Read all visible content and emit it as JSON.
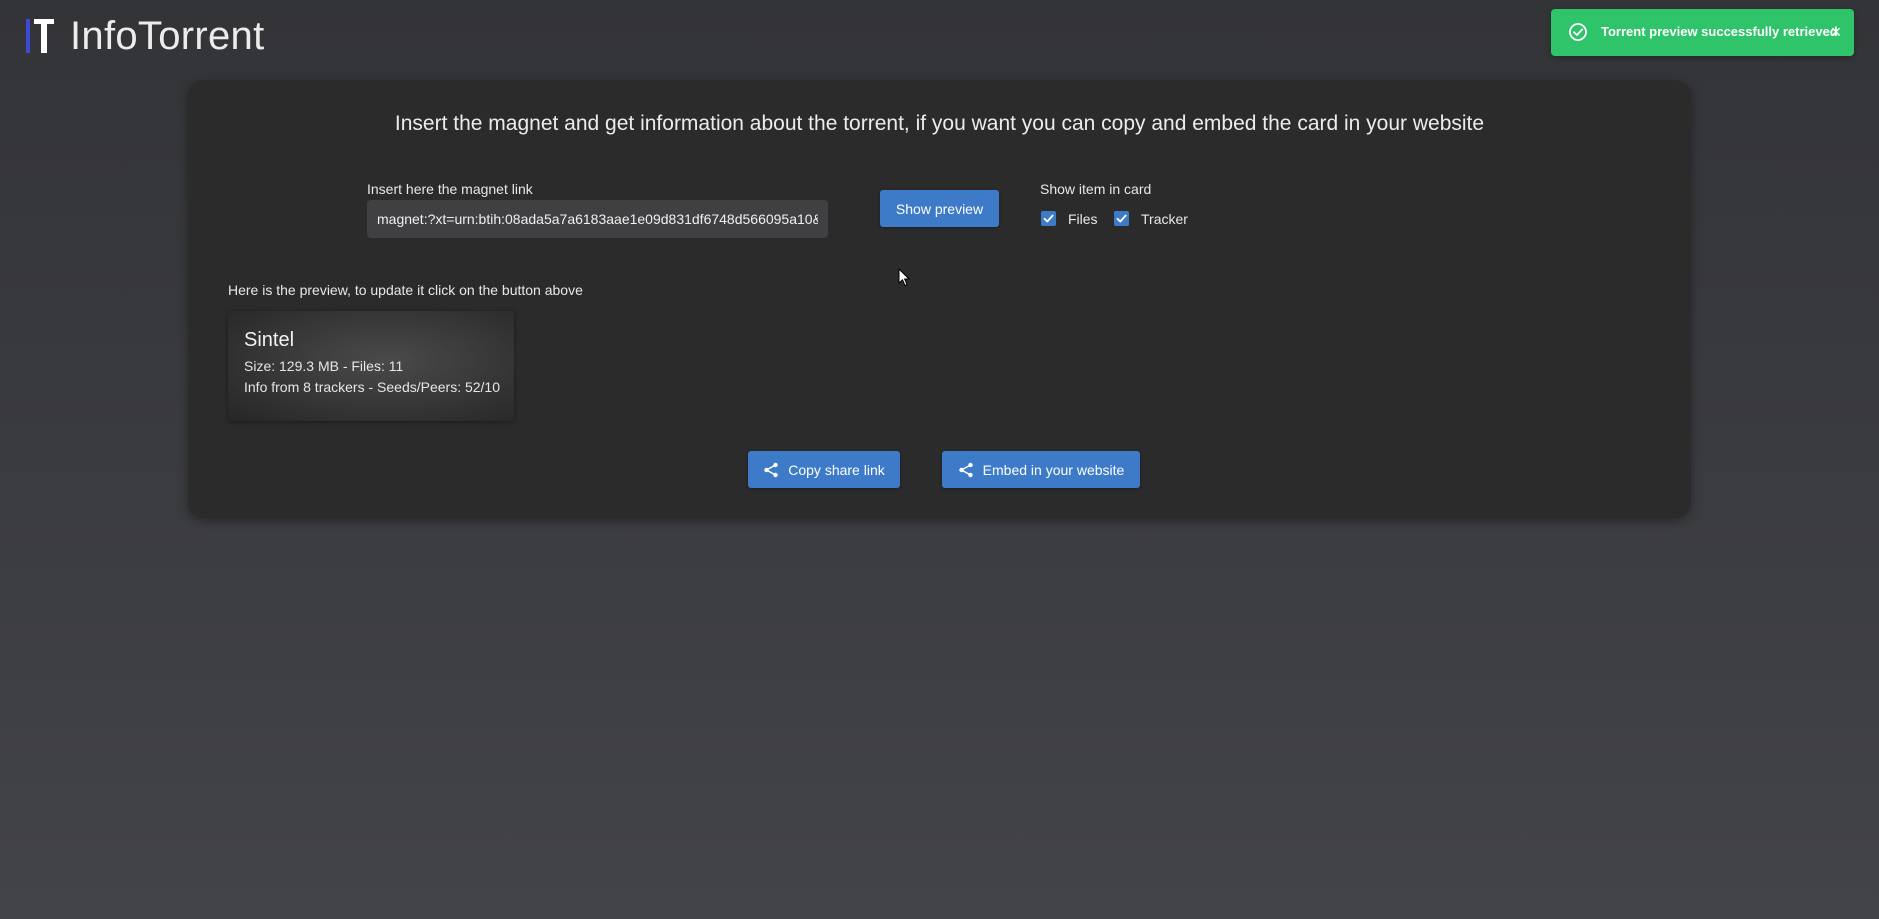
{
  "app": {
    "title": "InfoTorrent"
  },
  "toast": {
    "message": "Torrent preview successfully retrieved",
    "close_symbol": "×",
    "icon": "check-circle-icon",
    "color": "#2fc46a"
  },
  "main": {
    "headline": "Insert the magnet and get information about the torrent, if you want you can copy and embed the card in your website",
    "magnet_label": "Insert here the magnet link",
    "magnet_value": "magnet:?xt=urn:btih:08ada5a7a6183aae1e09d831df6748d566095a10&",
    "show_preview_label": "Show preview",
    "options_label": "Show item in card",
    "options": [
      {
        "label": "Files",
        "checked": true
      },
      {
        "label": "Tracker",
        "checked": true
      }
    ],
    "preview_label": "Here is the preview, to update it click on the button above",
    "card": {
      "title": "Sintel",
      "size_line": "Size: 129.3 MB - Files: 11",
      "info_line": "Info from 8 trackers - Seeds/Peers: 52/10"
    },
    "copy_share_label": "Copy share link",
    "embed_label": "Embed in your website"
  },
  "colors": {
    "accent": "#3d7bc9",
    "panel": "#2b2b2c",
    "logo_blue": "#3b4bd6"
  }
}
